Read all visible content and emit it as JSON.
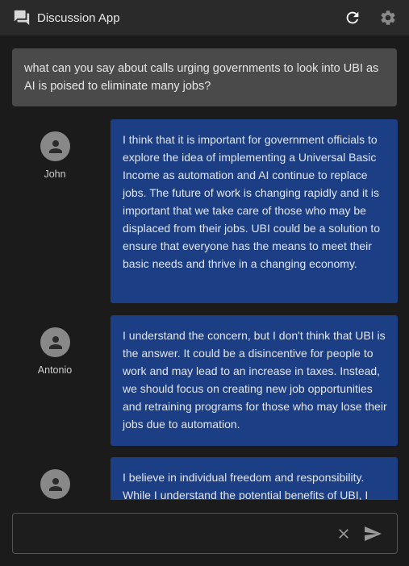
{
  "header": {
    "title": "Discussion App",
    "app_icon": "forum-icon",
    "refresh_icon": "refresh-icon",
    "settings_icon": "gear-icon"
  },
  "prompt": {
    "text": "what can you say about calls urging governments to look into UBI as AI is poised to eliminate many jobs?"
  },
  "messages": [
    {
      "name": "John",
      "text": "I think that it is important for government officials to explore the idea of implementing a Universal Basic Income as automation and AI continue to replace jobs. The future of work is changing rapidly and it is important that we take care of those who may be displaced from their jobs. UBI could be a solution to ensure that everyone has the means to meet their basic needs and thrive in a changing economy."
    },
    {
      "name": "Antonio",
      "text": "I understand the concern, but I don't think that UBI is the answer. It could be a disincentive for people to work and may lead to an increase in taxes. Instead, we should focus on creating new job opportunities and retraining programs for those who may lose their jobs due to automation."
    },
    {
      "name": "",
      "text": "I believe in individual freedom and responsibility. While I understand the potential benefits of UBI, I"
    }
  ],
  "composer": {
    "value": "",
    "placeholder": "",
    "clear_icon": "close-icon",
    "send_icon": "send-icon"
  },
  "colors": {
    "header_bg": "#2a2a2a",
    "page_bg": "#1b1b1b",
    "prompt_bg": "#4a4a4a",
    "bubble_bg": "#1c3e85",
    "avatar_bg": "#888888"
  }
}
